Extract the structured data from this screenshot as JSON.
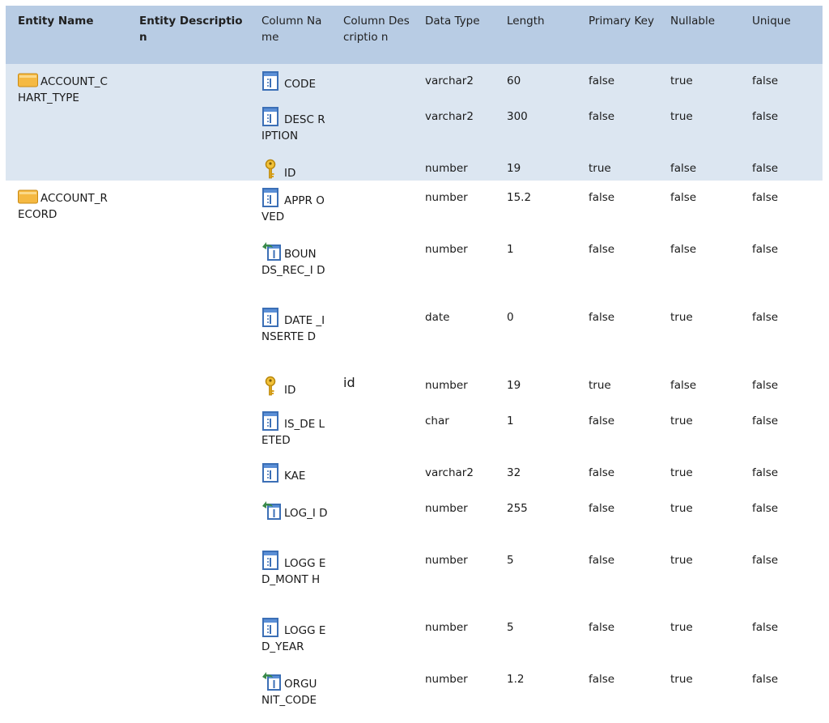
{
  "headers": [
    "Entity Name",
    "Entity Description",
    "Column Name",
    "Column Descriptio n",
    "Data Type",
    "Length",
    "Primary Key",
    "Nullable",
    "Unique"
  ],
  "entities": [
    {
      "name": "ACCOUNT_C HART_TYPE",
      "description": "",
      "columns": [
        {
          "name": "CODE",
          "icon": "column-icon",
          "description": "",
          "type": "varchar2",
          "length": "60",
          "pk": "false",
          "nullable": "true",
          "unique": "false"
        },
        {
          "name": "DESC RIPTION",
          "icon": "column-icon",
          "description": "",
          "type": "varchar2",
          "length": "300",
          "pk": "false",
          "nullable": "true",
          "unique": "false"
        },
        {
          "name": "ID",
          "icon": "key-icon",
          "description": "",
          "type": "number",
          "length": "19",
          "pk": "true",
          "nullable": "false",
          "unique": "false"
        }
      ]
    },
    {
      "name": "ACCOUNT_R ECORD",
      "description": "",
      "columns": [
        {
          "name": "APPR OVED",
          "icon": "column-icon",
          "description": "",
          "type": "number",
          "length": "15.2",
          "pk": "false",
          "nullable": "false",
          "unique": "false"
        },
        {
          "name": "BOUN DS_REC_I D",
          "icon": "foreign-key-icon",
          "description": "",
          "type": "number",
          "length": "1",
          "pk": "false",
          "nullable": "false",
          "unique": "false"
        },
        {
          "name": "DATE _INSERTE D",
          "icon": "column-icon",
          "description": "",
          "type": "date",
          "length": "0",
          "pk": "false",
          "nullable": "true",
          "unique": "false"
        },
        {
          "name": "ID",
          "icon": "key-icon",
          "description": "id",
          "type": "number",
          "length": "19",
          "pk": "true",
          "nullable": "false",
          "unique": "false"
        },
        {
          "name": "IS_DE LETED",
          "icon": "column-icon",
          "description": "",
          "type": "char",
          "length": "1",
          "pk": "false",
          "nullable": "true",
          "unique": "false"
        },
        {
          "name": "KAE",
          "icon": "column-icon",
          "description": "",
          "type": "varchar2",
          "length": "32",
          "pk": "false",
          "nullable": "true",
          "unique": "false"
        },
        {
          "name": "LOG_I D",
          "icon": "foreign-key-icon",
          "description": "",
          "type": "number",
          "length": "255",
          "pk": "false",
          "nullable": "true",
          "unique": "false"
        },
        {
          "name": "LOGG ED_MONT H",
          "icon": "column-icon",
          "description": "",
          "type": "number",
          "length": "5",
          "pk": "false",
          "nullable": "true",
          "unique": "false"
        },
        {
          "name": "LOGG ED_YEAR",
          "icon": "column-icon",
          "description": "",
          "type": "number",
          "length": "5",
          "pk": "false",
          "nullable": "true",
          "unique": "false"
        },
        {
          "name": "ORGU NIT_CODE",
          "icon": "foreign-key-icon",
          "description": "",
          "type": "number",
          "length": "1.2",
          "pk": "false",
          "nullable": "true",
          "unique": "false"
        }
      ]
    }
  ],
  "colors": {
    "header_bg": "#b8cce4",
    "shaded_bg": "#dce6f1",
    "folder": "#f5b942",
    "column_icon": "#3b6fb6",
    "key_icon": "#d9a21b",
    "fk_arrow": "#3a8a4a"
  }
}
